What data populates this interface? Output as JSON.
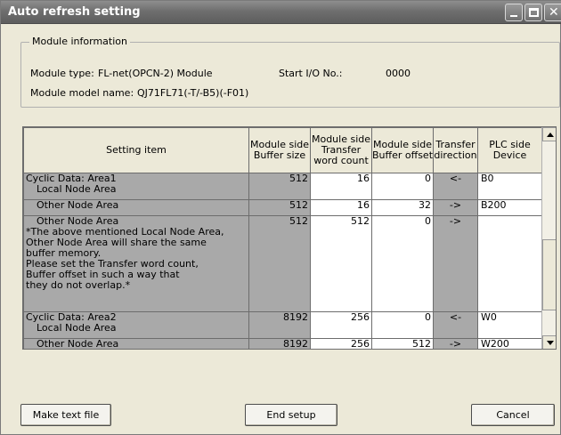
{
  "window": {
    "title": "Auto refresh setting"
  },
  "module_info": {
    "legend": "Module information",
    "type_label": "Module type:",
    "type_value": "FL-net(OPCN-2) Module",
    "start_io_label": "Start I/O No.:",
    "start_io_value": "0000",
    "model_label": "Module model name:",
    "model_value": "QJ71FL71(-T/-B5)(-F01)"
  },
  "grid": {
    "headers": {
      "setting_item": "Setting item",
      "buffer_size": [
        "Module side",
        "Buffer size"
      ],
      "transfer_count": [
        "Module side",
        "Transfer",
        "word count"
      ],
      "buffer_offset": [
        "Module side",
        "Buffer offset"
      ],
      "direction": [
        "Transfer",
        "direction"
      ],
      "plc_device": [
        "PLC side",
        "Device"
      ]
    },
    "rows": [
      {
        "item": [
          "Cyclic Data: Area1",
          "Local Node Area"
        ],
        "buffer_size": "512",
        "transfer_count": "16",
        "buffer_offset": "0",
        "direction": "<-",
        "device": "B0"
      },
      {
        "item": [
          "Other Node Area"
        ],
        "buffer_size": "512",
        "transfer_count": "16",
        "buffer_offset": "32",
        "direction": "->",
        "device": "B200"
      },
      {
        "item": [
          "Other Node Area",
          "*The above mentioned Local Node Area,",
          "Other Node Area will share the same",
          "buffer memory.",
          "Please set the Transfer word count,",
          "Buffer offset in  such a way that",
          "they do not overlap.*"
        ],
        "buffer_size": "512",
        "transfer_count": "512",
        "buffer_offset": "0",
        "direction": "->",
        "device": ""
      },
      {
        "item": [
          "Cyclic Data: Area2",
          "Local Node Area"
        ],
        "buffer_size": "8192",
        "transfer_count": "256",
        "buffer_offset": "0",
        "direction": "<-",
        "device": "W0"
      },
      {
        "item": [
          "Other Node Area"
        ],
        "buffer_size": "8192",
        "transfer_count": "256",
        "buffer_offset": "512",
        "direction": "->",
        "device": "W200"
      }
    ]
  },
  "buttons": {
    "make_text_file": "Make text file",
    "end_setup": "End setup",
    "cancel": "Cancel"
  }
}
